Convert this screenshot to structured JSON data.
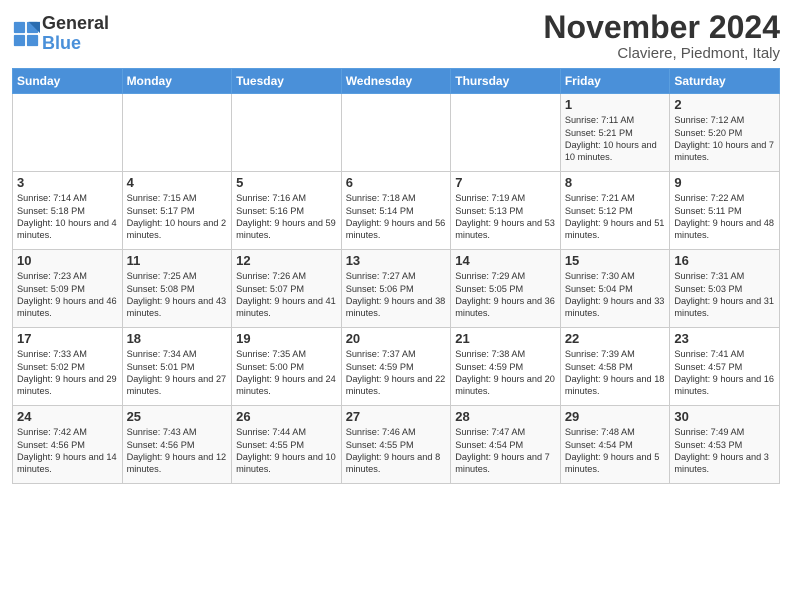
{
  "header": {
    "logo_line1": "General",
    "logo_line2": "Blue",
    "month_title": "November 2024",
    "location": "Claviere, Piedmont, Italy"
  },
  "weekdays": [
    "Sunday",
    "Monday",
    "Tuesday",
    "Wednesday",
    "Thursday",
    "Friday",
    "Saturday"
  ],
  "weeks": [
    [
      {
        "day": "",
        "info": ""
      },
      {
        "day": "",
        "info": ""
      },
      {
        "day": "",
        "info": ""
      },
      {
        "day": "",
        "info": ""
      },
      {
        "day": "",
        "info": ""
      },
      {
        "day": "1",
        "info": "Sunrise: 7:11 AM\nSunset: 5:21 PM\nDaylight: 10 hours and 10 minutes."
      },
      {
        "day": "2",
        "info": "Sunrise: 7:12 AM\nSunset: 5:20 PM\nDaylight: 10 hours and 7 minutes."
      }
    ],
    [
      {
        "day": "3",
        "info": "Sunrise: 7:14 AM\nSunset: 5:18 PM\nDaylight: 10 hours and 4 minutes."
      },
      {
        "day": "4",
        "info": "Sunrise: 7:15 AM\nSunset: 5:17 PM\nDaylight: 10 hours and 2 minutes."
      },
      {
        "day": "5",
        "info": "Sunrise: 7:16 AM\nSunset: 5:16 PM\nDaylight: 9 hours and 59 minutes."
      },
      {
        "day": "6",
        "info": "Sunrise: 7:18 AM\nSunset: 5:14 PM\nDaylight: 9 hours and 56 minutes."
      },
      {
        "day": "7",
        "info": "Sunrise: 7:19 AM\nSunset: 5:13 PM\nDaylight: 9 hours and 53 minutes."
      },
      {
        "day": "8",
        "info": "Sunrise: 7:21 AM\nSunset: 5:12 PM\nDaylight: 9 hours and 51 minutes."
      },
      {
        "day": "9",
        "info": "Sunrise: 7:22 AM\nSunset: 5:11 PM\nDaylight: 9 hours and 48 minutes."
      }
    ],
    [
      {
        "day": "10",
        "info": "Sunrise: 7:23 AM\nSunset: 5:09 PM\nDaylight: 9 hours and 46 minutes."
      },
      {
        "day": "11",
        "info": "Sunrise: 7:25 AM\nSunset: 5:08 PM\nDaylight: 9 hours and 43 minutes."
      },
      {
        "day": "12",
        "info": "Sunrise: 7:26 AM\nSunset: 5:07 PM\nDaylight: 9 hours and 41 minutes."
      },
      {
        "day": "13",
        "info": "Sunrise: 7:27 AM\nSunset: 5:06 PM\nDaylight: 9 hours and 38 minutes."
      },
      {
        "day": "14",
        "info": "Sunrise: 7:29 AM\nSunset: 5:05 PM\nDaylight: 9 hours and 36 minutes."
      },
      {
        "day": "15",
        "info": "Sunrise: 7:30 AM\nSunset: 5:04 PM\nDaylight: 9 hours and 33 minutes."
      },
      {
        "day": "16",
        "info": "Sunrise: 7:31 AM\nSunset: 5:03 PM\nDaylight: 9 hours and 31 minutes."
      }
    ],
    [
      {
        "day": "17",
        "info": "Sunrise: 7:33 AM\nSunset: 5:02 PM\nDaylight: 9 hours and 29 minutes."
      },
      {
        "day": "18",
        "info": "Sunrise: 7:34 AM\nSunset: 5:01 PM\nDaylight: 9 hours and 27 minutes."
      },
      {
        "day": "19",
        "info": "Sunrise: 7:35 AM\nSunset: 5:00 PM\nDaylight: 9 hours and 24 minutes."
      },
      {
        "day": "20",
        "info": "Sunrise: 7:37 AM\nSunset: 4:59 PM\nDaylight: 9 hours and 22 minutes."
      },
      {
        "day": "21",
        "info": "Sunrise: 7:38 AM\nSunset: 4:59 PM\nDaylight: 9 hours and 20 minutes."
      },
      {
        "day": "22",
        "info": "Sunrise: 7:39 AM\nSunset: 4:58 PM\nDaylight: 9 hours and 18 minutes."
      },
      {
        "day": "23",
        "info": "Sunrise: 7:41 AM\nSunset: 4:57 PM\nDaylight: 9 hours and 16 minutes."
      }
    ],
    [
      {
        "day": "24",
        "info": "Sunrise: 7:42 AM\nSunset: 4:56 PM\nDaylight: 9 hours and 14 minutes."
      },
      {
        "day": "25",
        "info": "Sunrise: 7:43 AM\nSunset: 4:56 PM\nDaylight: 9 hours and 12 minutes."
      },
      {
        "day": "26",
        "info": "Sunrise: 7:44 AM\nSunset: 4:55 PM\nDaylight: 9 hours and 10 minutes."
      },
      {
        "day": "27",
        "info": "Sunrise: 7:46 AM\nSunset: 4:55 PM\nDaylight: 9 hours and 8 minutes."
      },
      {
        "day": "28",
        "info": "Sunrise: 7:47 AM\nSunset: 4:54 PM\nDaylight: 9 hours and 7 minutes."
      },
      {
        "day": "29",
        "info": "Sunrise: 7:48 AM\nSunset: 4:54 PM\nDaylight: 9 hours and 5 minutes."
      },
      {
        "day": "30",
        "info": "Sunrise: 7:49 AM\nSunset: 4:53 PM\nDaylight: 9 hours and 3 minutes."
      }
    ]
  ]
}
